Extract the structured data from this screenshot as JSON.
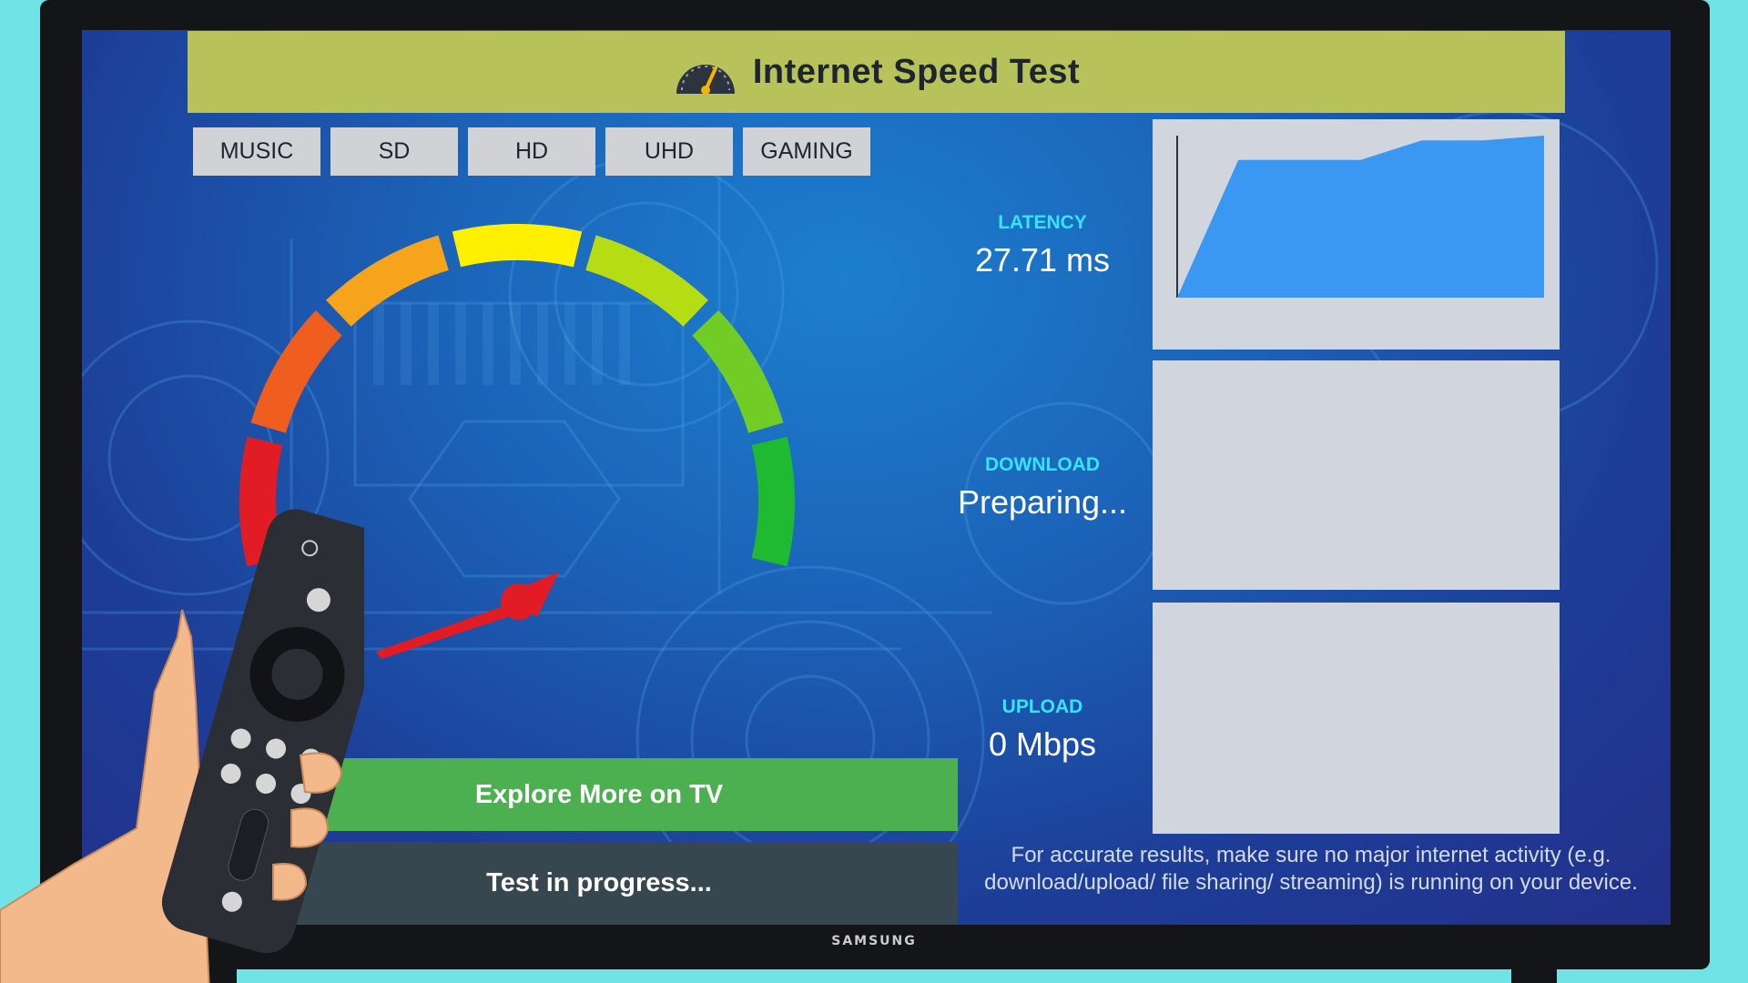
{
  "app": {
    "title": "Internet Speed Test",
    "logo_icon": "speedometer-icon"
  },
  "tabs": [
    {
      "label": "MUSIC"
    },
    {
      "label": "SD"
    },
    {
      "label": "HD"
    },
    {
      "label": "UHD"
    },
    {
      "label": "GAMING"
    }
  ],
  "gauge": {
    "segment_colors": [
      "#e21c24",
      "#ef5d1f",
      "#f7a41d",
      "#ffef00",
      "#b6dc14",
      "#72cc26",
      "#1fba31"
    ],
    "needle_color": "#e21c24"
  },
  "metrics": {
    "latency": {
      "label": "LATENCY",
      "value": "27.71 ms"
    },
    "download": {
      "label": "DOWNLOAD",
      "value": "Preparing..."
    },
    "upload": {
      "label": "UPLOAD",
      "value": "0 Mbps"
    }
  },
  "latency_graph": {
    "fill_color": "#3a97f2",
    "levels": [
      0,
      0.85,
      0.85,
      0.85,
      0.97,
      0.97,
      1.0
    ]
  },
  "buttons": {
    "explore": "Explore More on TV",
    "status": "Test in progress..."
  },
  "notice": "For accurate results, make sure no major internet activity (e.g. download/upload/ file sharing/ streaming) is running on your device.",
  "tv": {
    "brand": "SAMSUNG"
  },
  "colors": {
    "title_bar": "#b8c25a",
    "tab_bg": "#d0d2d6",
    "explore_bg": "#4caf50",
    "status_bg": "#37474f",
    "label_cyan": "#38e3ff"
  }
}
